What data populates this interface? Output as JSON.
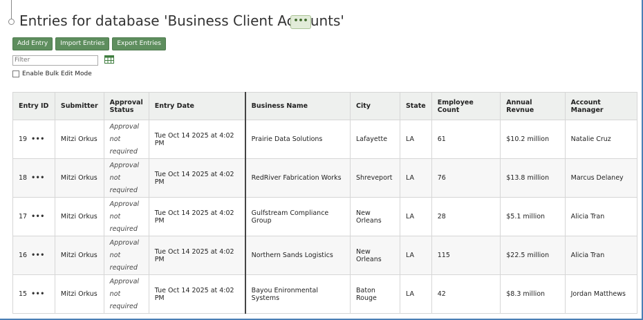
{
  "header": {
    "title": "Entries for database 'Business Client Accounts'",
    "more_label": "•••"
  },
  "toolbar": {
    "add_label": "Add Entry",
    "import_label": "Import Entries",
    "export_label": "Export Entries"
  },
  "filter": {
    "placeholder": "Filter"
  },
  "bulk_edit_label": "Enable Bulk Edit Mode",
  "table": {
    "columns": [
      "Entry ID",
      "Submitter",
      "Approval Status",
      "Entry Date",
      "Business Name",
      "City",
      "State",
      "Employee Count",
      "Annual Revnue",
      "Account Manager"
    ],
    "rows": [
      {
        "id": "19",
        "submitter": "Mitzi Orkus",
        "approval": [
          "Approval",
          "not",
          "required"
        ],
        "date": "Tue Oct 14 2025 at 4:02 PM",
        "business": "Prairie Data Solutions",
        "city": "Lafayette",
        "state": "LA",
        "employees": "61",
        "revenue": "$10.2 million",
        "manager": "Natalie Cruz"
      },
      {
        "id": "18",
        "submitter": "Mitzi Orkus",
        "approval": [
          "Approval",
          "not",
          "required"
        ],
        "date": "Tue Oct 14 2025 at 4:02 PM",
        "business": "RedRiver Fabrication Works",
        "city": "Shreveport",
        "state": "LA",
        "employees": "76",
        "revenue": "$13.8 million",
        "manager": "Marcus Delaney"
      },
      {
        "id": "17",
        "submitter": "Mitzi Orkus",
        "approval": [
          "Approval",
          "not",
          "required"
        ],
        "date": "Tue Oct 14 2025 at 4:02 PM",
        "business": "Gulfstream Compliance Group",
        "city": "New Orleans",
        "state": "LA",
        "employees": "28",
        "revenue": "$5.1 million",
        "manager": "Alicia Tran"
      },
      {
        "id": "16",
        "submitter": "Mitzi Orkus",
        "approval": [
          "Approval",
          "not",
          "required"
        ],
        "date": "Tue Oct 14 2025 at 4:02 PM",
        "business": "Northern Sands Logistics",
        "city": "New Orleans",
        "state": "LA",
        "employees": "115",
        "revenue": "$22.5 million",
        "manager": "Alicia Tran"
      },
      {
        "id": "15",
        "submitter": "Mitzi Orkus",
        "approval": [
          "Approval",
          "not",
          "required"
        ],
        "date": "Tue Oct 14 2025 at 4:02 PM",
        "business": "Bayou Enironmental Systems",
        "city": "Baton Rouge",
        "state": "LA",
        "employees": "42",
        "revenue": "$8.3 million",
        "manager": "Jordan Matthews"
      }
    ],
    "row_menu_label": "•••"
  }
}
